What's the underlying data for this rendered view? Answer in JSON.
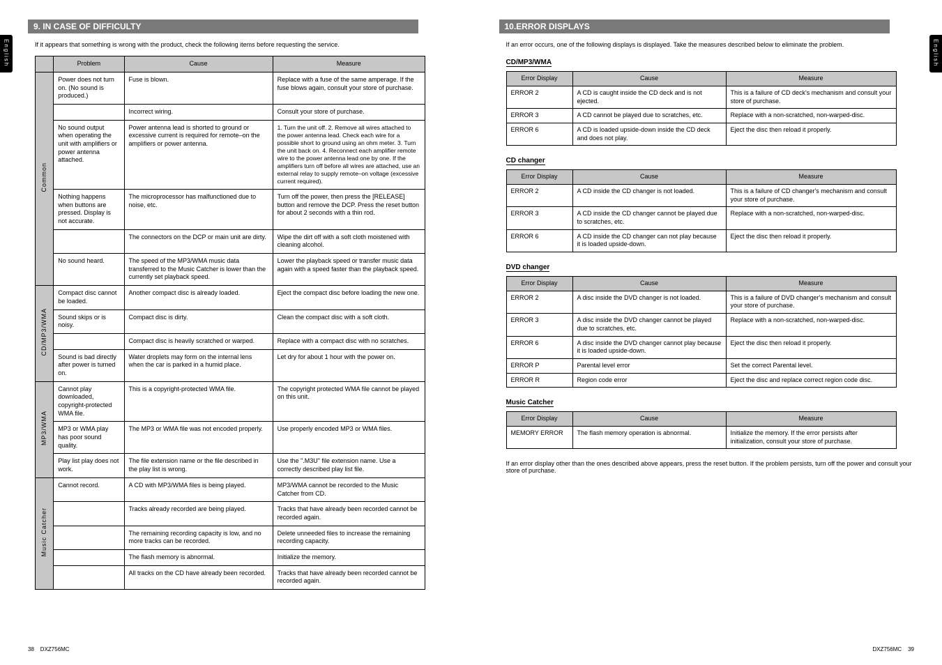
{
  "left": {
    "tab": "English",
    "section_title": "9. IN CASE OF DIFFICULTY",
    "intro": "If it appears that something is wrong with the product, check the following items before requesting the service.",
    "table": {
      "headers": [
        "",
        "Problem",
        "Cause",
        "Measure"
      ],
      "groups": [
        {
          "label": "Common",
          "rows": [
            {
              "problem": "Power does not turn on.\n(No sound is produced.)",
              "cause": "Fuse is blown.",
              "measure": "Replace with a fuse of the same amperage. If the fuse blows again, consult your store of purchase."
            },
            {
              "problem": "",
              "cause": "Incorrect wiring.",
              "measure": "Consult your store of purchase."
            },
            {
              "problem": "No sound output when operating the unit with amplifiers or power antenna attached.",
              "cause": "Power antenna lead is shorted to ground or excessive current is required for remote–on the amplifiers or power antenna.",
              "measure": "1. Turn the unit off.\n2. Remove all wires attached to the power antenna lead. Check each wire for a possible short to ground using an ohm meter.\n3. Turn the unit back on.\n4. Reconnect each amplifier remote wire to the power antenna lead one by one. If the amplifiers turn off before all wires are attached, use an external relay to supply remote–on voltage (excessive current required)."
            },
            {
              "problem": "Nothing happens when buttons are pressed.\nDisplay is not accurate.",
              "cause": "The microprocessor has malfunctioned due to noise, etc.",
              "measure": "Turn off the power, then press the [RELEASE] button and remove the DCP.\nPress the reset button for about 2 seconds with a thin rod."
            },
            {
              "problem": "",
              "cause": "The connectors on the DCP or main unit are dirty.",
              "measure": "Wipe the dirt off with a soft cloth moistened with cleaning alcohol."
            },
            {
              "problem": "No sound heard.",
              "cause": "The speed of the MP3/WMA music data transferred to the Music Catcher is lower than the currently set playback speed.",
              "measure": "Lower the playback speed or transfer music data again with a speed faster than the playback speed."
            }
          ]
        },
        {
          "label": "CD/MP3/WMA",
          "rows": [
            {
              "problem": "Compact disc cannot be loaded.",
              "cause": "Another compact disc is already loaded.",
              "measure": "Eject the compact disc before loading the new one."
            },
            {
              "problem": "Sound skips or is noisy.",
              "cause": "Compact disc is dirty.",
              "measure": "Clean the compact disc with a soft cloth."
            },
            {
              "problem": "",
              "cause": "Compact disc is heavily scratched or warped.",
              "measure": "Replace with a compact disc with no scratches."
            },
            {
              "problem": "Sound is bad directly after power is turned on.",
              "cause": "Water droplets may form on the internal lens when the car is parked in a humid place.",
              "measure": "Let dry for about 1 hour with the power on."
            }
          ]
        },
        {
          "label": "MP3/WMA",
          "rows": [
            {
              "problem": "Cannot play downloaded, copyright-protected WMA file.",
              "cause": "This is a copyright-protected WMA file.",
              "measure": "The copyright protected WMA file cannot be played on this unit."
            },
            {
              "problem": "MP3 or WMA play has poor sound quality.",
              "cause": "The MP3 or WMA file was not encoded properly.",
              "measure": "Use properly encoded MP3 or WMA files."
            },
            {
              "problem": "Play list play does not work.",
              "cause": "The file extension name or the file described in the play list is wrong.",
              "measure": "Use the \".M3U\" file extension name.\nUse a correctly described play list file."
            }
          ]
        },
        {
          "label": "Music Catcher",
          "rows": [
            {
              "problem": "Cannot record.",
              "cause": "A CD with MP3/WMA files is being played.",
              "measure": "MP3/WMA cannot be recorded to the Music Catcher from CD."
            },
            {
              "problem": "",
              "cause": "Tracks already recorded are being played.",
              "measure": "Tracks that have already been recorded cannot be recorded again."
            },
            {
              "problem": "",
              "cause": "The remaining recording capacity is low, and no more tracks can be recorded.",
              "measure": "Delete unneeded files to increase the remaining recording capacity."
            },
            {
              "problem": "",
              "cause": "The flash memory is abnormal.",
              "measure": "Initialize the memory."
            },
            {
              "problem": "",
              "cause": "All tracks on the CD have already been recorded.",
              "measure": "Tracks that have already been recorded cannot be recorded again."
            }
          ]
        }
      ]
    },
    "footer_page": "38",
    "footer_model": "DXZ756MC"
  },
  "right": {
    "tab": "English",
    "section_title": "10.ERROR DISPLAYS",
    "intro": "If an error occurs, one of the following displays is displayed.\nTake the measures described below to eliminate the problem.",
    "tables": [
      {
        "heading": "CD/MP3/WMA",
        "headers": [
          "Error Display",
          "Cause",
          "Measure"
        ],
        "rows": [
          {
            "disp": "ERROR 2",
            "cause": "A CD is caught inside the CD deck and is not ejected.",
            "measure": "This is a failure of CD deck's mechanism and consult your store of purchase."
          },
          {
            "disp": "ERROR 3",
            "cause": "A CD cannot be played due to scratches, etc.",
            "measure": "Replace with a non-scratched, non-warped-disc."
          },
          {
            "disp": "ERROR 6",
            "cause": "A CD is loaded upside-down inside the CD deck and does not play.",
            "measure": "Eject the disc then reload it properly."
          }
        ]
      },
      {
        "heading": "CD changer",
        "headers": [
          "Error Display",
          "Cause",
          "Measure"
        ],
        "rows": [
          {
            "disp": "ERROR 2",
            "cause": "A CD inside the CD changer is not loaded.",
            "measure": "This is a failure of CD changer's mechanism and consult your store of purchase."
          },
          {
            "disp": "ERROR 3",
            "cause": "A CD inside the CD changer cannot be played due to scratches, etc.",
            "measure": "Replace with a non-scratched, non-warped-disc."
          },
          {
            "disp": "ERROR 6",
            "cause": "A CD inside the CD changer can not play because it is loaded upside-down.",
            "measure": "Eject the disc then reload it properly."
          }
        ]
      },
      {
        "heading": "DVD changer",
        "headers": [
          "Error Display",
          "Cause",
          "Measure"
        ],
        "rows": [
          {
            "disp": "ERROR 2",
            "cause": "A disc inside the DVD changer is not loaded.",
            "measure": "This is a failure of DVD changer's mechanism and consult your store of purchase."
          },
          {
            "disp": "ERROR 3",
            "cause": "A disc inside the DVD changer cannot be played due to scratches, etc.",
            "measure": "Replace with a non-scratched, non-warped-disc."
          },
          {
            "disp": "ERROR 6",
            "cause": "A disc inside the DVD changer cannot play because it is loaded upside-down.",
            "measure": "Eject the disc then reload it properly."
          },
          {
            "disp": "ERROR P",
            "cause": "Parental level error",
            "measure": "Set the correct Parental level."
          },
          {
            "disp": "ERROR R",
            "cause": "Region code error",
            "measure": "Eject the disc and replace correct region code disc."
          }
        ]
      },
      {
        "heading": "Music Catcher",
        "headers": [
          "Error Display",
          "Cause",
          "Measure"
        ],
        "rows": [
          {
            "disp": "MEMORY ERROR",
            "cause": "The flash memory operation is abnormal.",
            "measure": "Initialize the memory. If the error persists after initialization, consult your store of purchase."
          }
        ]
      }
    ],
    "note": "If an error display other than the ones described above appears, press the reset button. If the problem persists, turn off the power and consult your store of purchase.",
    "footer_page": "39",
    "footer_model": "DXZ756MC"
  }
}
